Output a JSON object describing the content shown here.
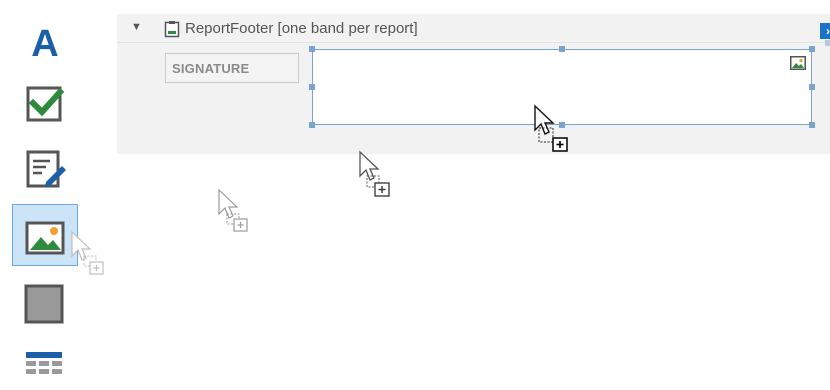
{
  "toolbox": {
    "items": [
      {
        "name": "label-tool",
        "icon": "text-label-icon",
        "glyph": "A",
        "color": "#1a5fa8"
      },
      {
        "name": "checkbox-tool",
        "icon": "checkbox-icon",
        "color": "#2e7d32"
      },
      {
        "name": "richtext-tool",
        "icon": "document-edit-icon",
        "color": "#1a5fa8"
      },
      {
        "name": "picturebox-tool",
        "icon": "picture-icon",
        "selected": true
      },
      {
        "name": "panel-tool",
        "icon": "panel-icon"
      },
      {
        "name": "table-tool",
        "icon": "table-icon",
        "color": "#1a5fa8"
      }
    ]
  },
  "band": {
    "title": "ReportFooter [one band per report]",
    "caret": "▼",
    "expand_glyph": "›"
  },
  "label_control": {
    "text": "SIGNATURE"
  },
  "colors": {
    "accent": "#1a73c7",
    "selection_border": "#7aa3cf",
    "band_bg": "#f2f2f2",
    "selected_tool_bg": "#cce4f7"
  }
}
